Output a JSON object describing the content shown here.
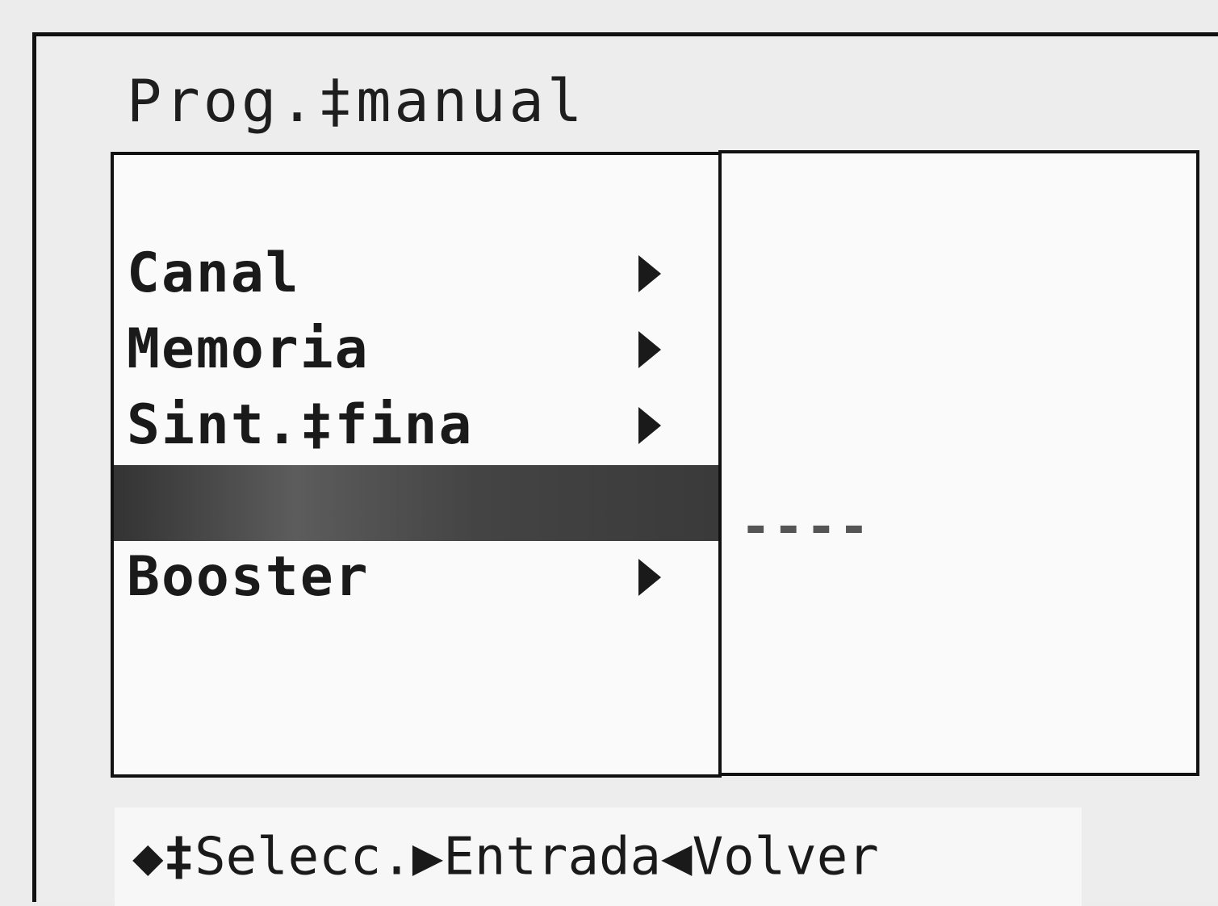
{
  "window": {
    "title": "Prog.‡manual"
  },
  "menu": {
    "items": [
      {
        "label": "Canal",
        "arrow": "right-arrow-icon"
      },
      {
        "label": "Memoria",
        "arrow": "right-arrow-icon"
      },
      {
        "label": "Sint.‡fina",
        "arrow": "right-arrow-icon"
      },
      {
        "label": "",
        "selected": true
      },
      {
        "label": "Booster",
        "arrow": "right-arrow-icon"
      }
    ]
  },
  "value_panel": {
    "selected_value": "----"
  },
  "footer": {
    "select_icon": "◆‡",
    "select_label": "Selecc.",
    "enter_icon": "▶",
    "enter_label": "Entrada",
    "back_icon": "◀",
    "back_label": "Volver"
  },
  "colors": {
    "background": "#ededed",
    "panel": "#fafafa",
    "border": "#111111",
    "highlight": "#4a4a4a",
    "text": "#1a1a1a"
  }
}
